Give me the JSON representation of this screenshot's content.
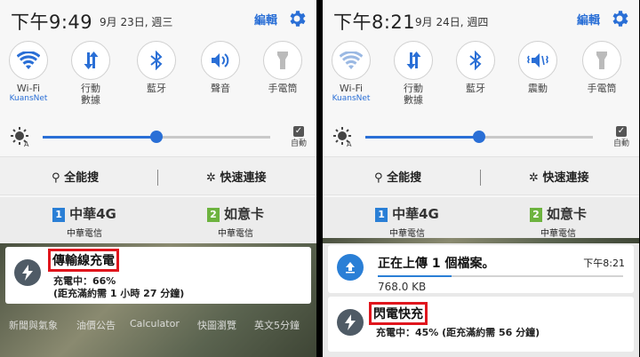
{
  "left": {
    "status": {
      "time": "下午9:49",
      "date": "9月 23日, 週三",
      "edit_label": "編輯"
    },
    "toggles": [
      {
        "label": "Wi-Fi",
        "sub": "KuansNet",
        "icon": "wifi-icon"
      },
      {
        "label": "行動\n數據",
        "sub": "",
        "icon": "mobile-data-icon"
      },
      {
        "label": "藍牙",
        "sub": "",
        "icon": "bluetooth-icon"
      },
      {
        "label": "聲音",
        "sub": "",
        "icon": "sound-icon"
      },
      {
        "label": "手電筒",
        "sub": "",
        "icon": "flashlight-icon"
      }
    ],
    "brightness": {
      "level": 0.5,
      "auto_label": "自動"
    },
    "search": {
      "finder_label": "全能搜",
      "quick_connect_label": "快速連接"
    },
    "sims": [
      {
        "badge": "1",
        "name": "中華4G",
        "sub": "中華電信",
        "color": "#2a7fd6"
      },
      {
        "badge": "2",
        "name": "如意卡",
        "sub": "中華電信",
        "color": "#6db33f"
      }
    ],
    "notification": {
      "title": "傳輸線充電",
      "line1": "充電中：66%",
      "line2": "(距充滿約需 1 小時 27 分鐘)"
    },
    "apps": [
      "新聞與氣象",
      "油價公告",
      "Calculator",
      "快圖瀏覽",
      "英文5分鐘"
    ]
  },
  "right": {
    "status": {
      "time": "下午8:21",
      "date": "9月 24日, 週四",
      "edit_label": "編輯"
    },
    "toggles": [
      {
        "label": "Wi-Fi",
        "sub": "KuansNet",
        "icon": "wifi-icon"
      },
      {
        "label": "行動\n數據",
        "sub": "",
        "icon": "mobile-data-icon"
      },
      {
        "label": "藍牙",
        "sub": "",
        "icon": "bluetooth-icon"
      },
      {
        "label": "震動",
        "sub": "",
        "icon": "vibrate-icon"
      },
      {
        "label": "手電筒",
        "sub": "",
        "icon": "flashlight-icon"
      }
    ],
    "brightness": {
      "level": 0.5,
      "auto_label": "自動"
    },
    "search": {
      "finder_label": "全能搜",
      "quick_connect_label": "快速連接"
    },
    "sims": [
      {
        "badge": "1",
        "name": "中華4G",
        "sub": "中華電信",
        "color": "#2a7fd6"
      },
      {
        "badge": "2",
        "name": "如意卡",
        "sub": "中華電信",
        "color": "#6db33f"
      }
    ],
    "upload": {
      "title": "正在上傳 1 個檔案。",
      "time": "下午8:21",
      "size": "768.0 KB",
      "progress": 0.3
    },
    "notification": {
      "title": "閃電快充",
      "line1": "充電中：45% (距充滿約需 56 分鐘)"
    }
  },
  "colors": {
    "accent": "#2a6fd6",
    "highlight_border": "#e0161d"
  }
}
